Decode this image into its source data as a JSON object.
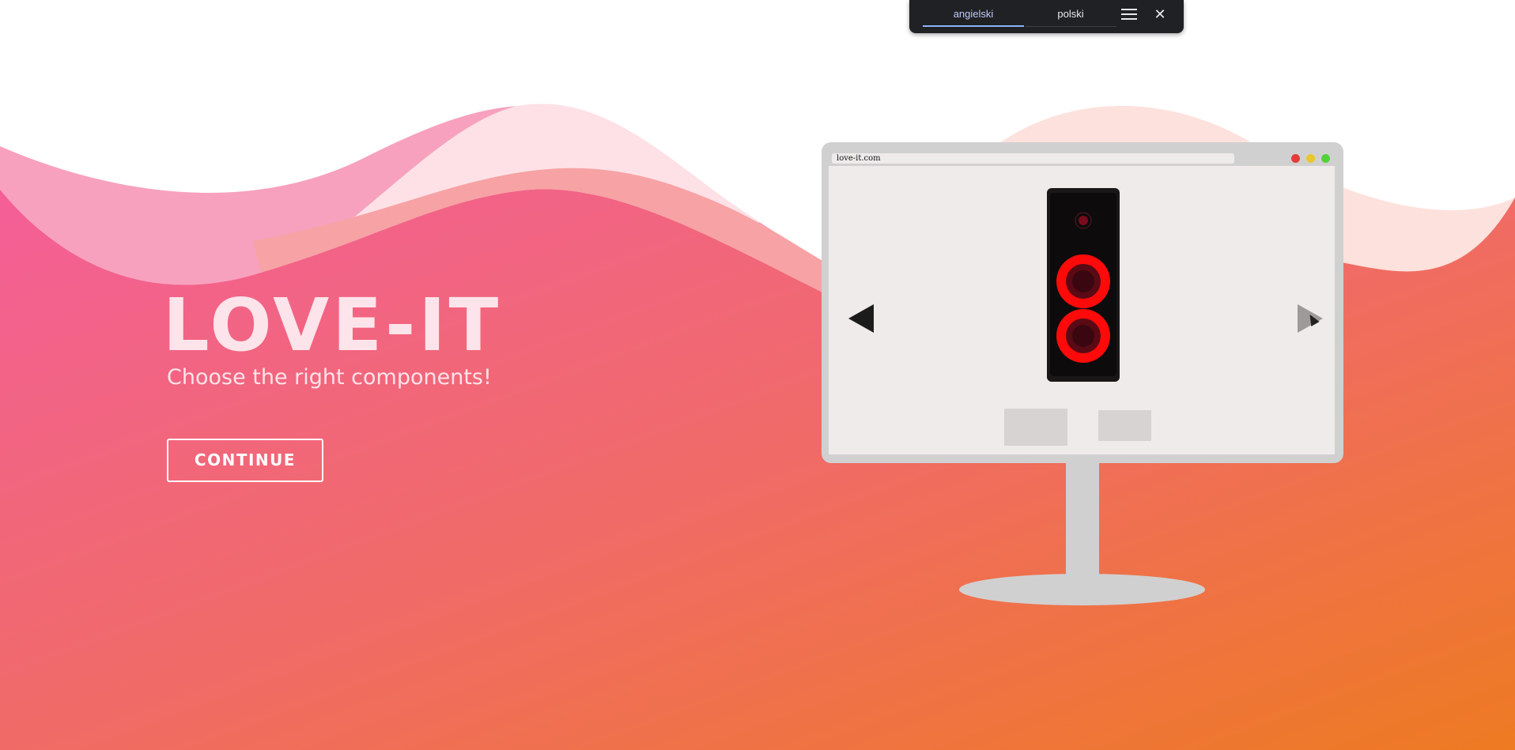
{
  "translate_bar": {
    "tabs": [
      {
        "label": "angielski",
        "active": true
      },
      {
        "label": "polski",
        "active": false
      }
    ],
    "menu_icon": "hamburger-menu-icon",
    "close_icon": "close-icon",
    "close_glyph": "✕"
  },
  "hero": {
    "title": "LOVE-IT",
    "tagline": "Choose the right components!",
    "continue_label": "CONTINUE"
  },
  "monitor": {
    "address": "love-it.com",
    "window_controls": [
      "close-dot",
      "minimize-dot",
      "maximize-dot"
    ],
    "carousel": {
      "prev_icon": "triangle-left-icon",
      "next_icon": "triangle-right-icon",
      "item": "pc-case-image"
    }
  },
  "colors": {
    "gradient_start": "#f45f98",
    "gradient_end": "#ee7a22",
    "title_color": "#fde4ea",
    "monitor_frame": "#d1d0d1",
    "screen_bg": "#efebeb",
    "accent_red": "#ff0a0a"
  }
}
